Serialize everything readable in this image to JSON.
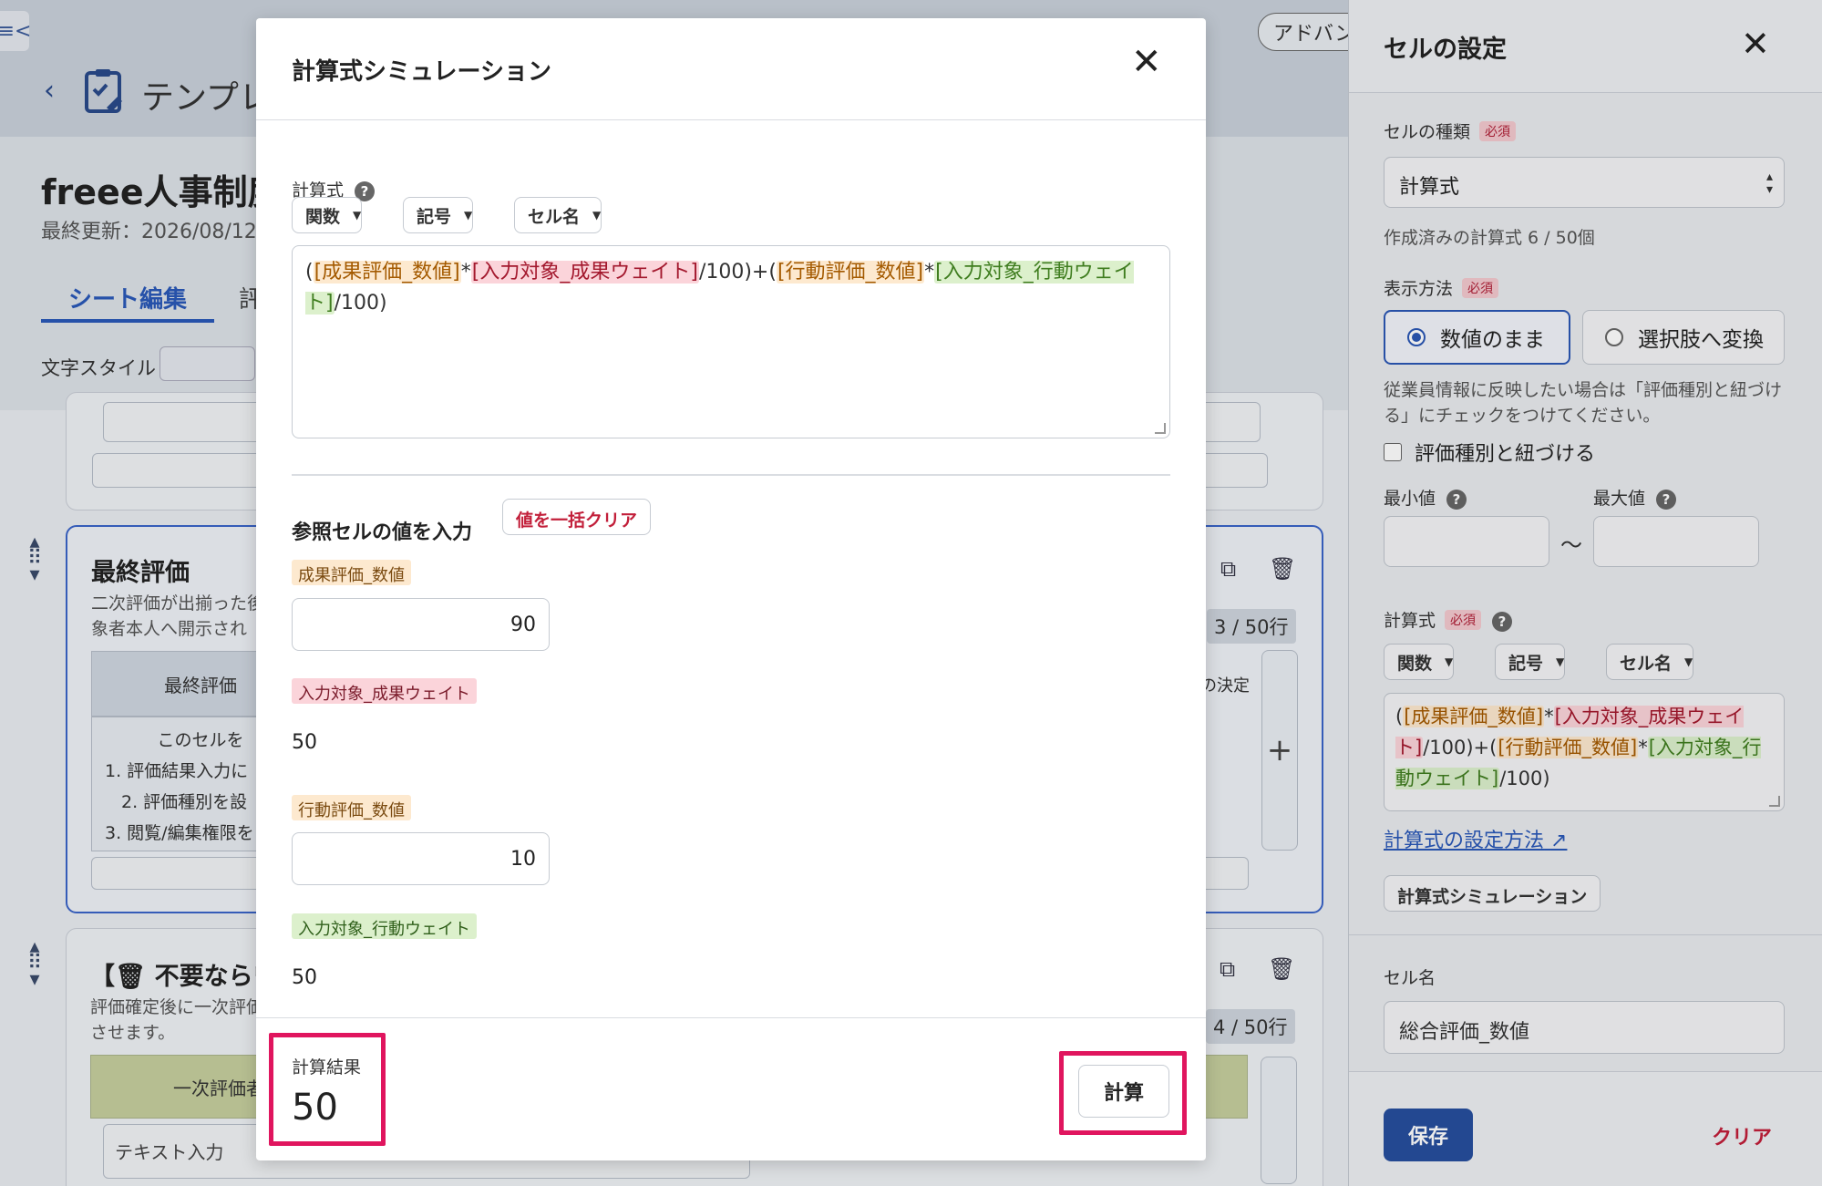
{
  "background": {
    "collapse_label": "≡<",
    "template_title": "テンプレ",
    "advanced_label": "アドバン",
    "page_title": "freee人事制度",
    "updated": "最終更新：2026/08/12",
    "tabs": [
      "シート編集",
      "評"
    ],
    "text_style_label": "文字スタイル",
    "final_card": {
      "title": "最終評価",
      "desc": "二次評価が出揃った後\n象者本人へ開示され",
      "head": "最終評価",
      "body": [
        "このセルを",
        "1. 評価結果入力に",
        "2. 評価種別を設",
        "3. 閲覧/編集権限を"
      ],
      "rows_badge": "3 / 50行",
      "decision_label": "の決定"
    },
    "unneeded_card": {
      "title": "【🗑 不要ならワ",
      "desc": "評価確定後に一次評価\nさせます。",
      "head": "一次評価者",
      "text_input": "テキスト入力",
      "rows_badge": "4 / 50行"
    }
  },
  "modal": {
    "title": "計算式シミュレーション",
    "close_icon": "close-icon",
    "formula_label": "計算式",
    "dropdowns": [
      "関数",
      "記号",
      "セル名"
    ],
    "formula_tokens": [
      {
        "t": "(",
        "c": ""
      },
      {
        "t": "[成果評価_数値]",
        "c": "o"
      },
      {
        "t": "*",
        "c": ""
      },
      {
        "t": "[入力対象_成果ウェイト]",
        "c": "r"
      },
      {
        "t": "/100)+(",
        "c": ""
      },
      {
        "t": "[行動評価_数値]",
        "c": "o"
      },
      {
        "t": "*",
        "c": ""
      },
      {
        "t": "[入力対象_行動ウェイト]",
        "c": "g"
      },
      {
        "t": "/100)",
        "c": ""
      }
    ],
    "section_title": "参照セルの値を入力",
    "clear_all_label": "値を一括クリア",
    "inputs": [
      {
        "name": "成果評価_数値",
        "value": "90",
        "type": "input",
        "color": "o"
      },
      {
        "name": "入力対象_成果ウェイト",
        "value": "50",
        "type": "static",
        "color": "r"
      },
      {
        "name": "行動評価_数値",
        "value": "10",
        "type": "input",
        "color": "o"
      },
      {
        "name": "入力対象_行動ウェイト",
        "value": "50",
        "type": "static",
        "color": "g"
      }
    ],
    "result_label": "計算結果",
    "result_value": "50",
    "calc_button": "計算"
  },
  "panel": {
    "title": "セルの設定",
    "cell_type_label": "セルの種類",
    "required": "必須",
    "cell_type_value": "計算式",
    "formula_count": "作成済みの計算式 6 / 50個",
    "display_label": "表示方法",
    "radio_options": [
      "数値のまま",
      "選択肢へ変換"
    ],
    "selected_radio": "数値のまま",
    "note": "従業員情報に反映したい場合は「評価種別と紐づける」にチェックをつけてください。",
    "link_checkbox": "評価種別と紐づける",
    "min_label": "最小値",
    "max_label": "最大値",
    "tilde": "〜",
    "formula_label": "計算式",
    "dropdowns": [
      "関数",
      "記号",
      "セル名"
    ],
    "formula_tokens": [
      {
        "t": "(",
        "c": ""
      },
      {
        "t": "[成果評価_数値]",
        "c": "o"
      },
      {
        "t": "*",
        "c": ""
      },
      {
        "t": "[入力対象_成果ウェイト]",
        "c": "r"
      },
      {
        "t": "/100)+(",
        "c": ""
      },
      {
        "t": "[行動評価_数値]",
        "c": "o"
      },
      {
        "t": "*",
        "c": ""
      },
      {
        "t": "[入力対象_行動ウェイト]",
        "c": "g"
      },
      {
        "t": "/100)",
        "c": ""
      }
    ],
    "help_link": "計算式の設定方法",
    "simulation_button": "計算式シミュレーション",
    "cell_name_label": "セル名",
    "cell_name_value": "総合評価_数値",
    "save_button": "保存",
    "clear_button": "クリア"
  },
  "colors": {
    "accent": "#2b57b5",
    "danger": "#c21f3a",
    "highlight": "#e0155e",
    "token_orange": "#fde9cf",
    "token_red": "#fbd4da",
    "token_green": "#dcf0cc"
  }
}
